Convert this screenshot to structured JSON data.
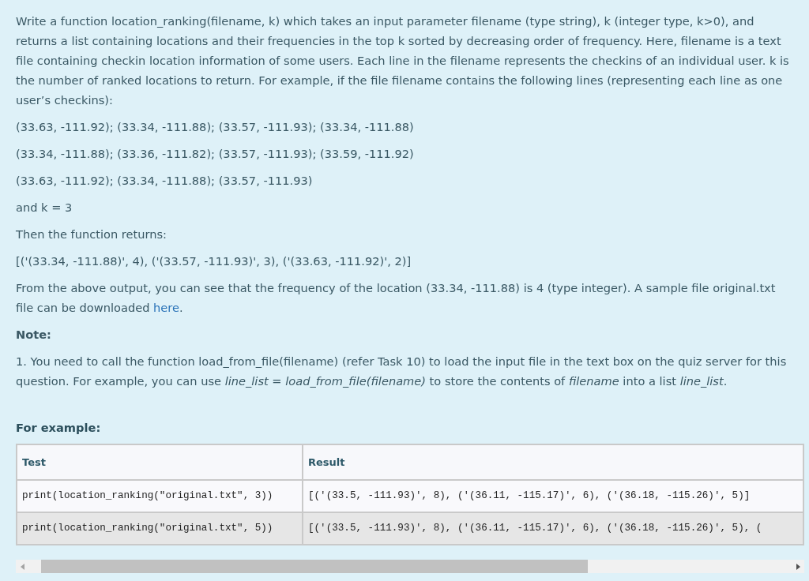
{
  "intro": "Write a function location_ranking(filename, k) which takes an input parameter filename (type string), k (integer type, k>0), and returns a list containing locations and their frequencies in the top k sorted by decreasing order of frequency.  Here, filename is a text file containing checkin location information of some users. Each line in the filename represents the checkins of an individual user. k is the number of ranked locations to return. For example, if the file filename contains the following lines (representing each line as one user’s checkins):",
  "file_lines": [
    "(33.63, -111.92); (33.34, -111.88); (33.57, -111.93); (33.34, -111.88)",
    "(33.34, -111.88); (33.36, -111.82); (33.57, -111.93); (33.59, -111.92)",
    "(33.63, -111.92); (33.34, -111.88); (33.57, -111.93)"
  ],
  "k_line": "and k = 3",
  "returns_line": "Then the function returns:",
  "output_line": "[('(33.34, -111.88)', 4), ('(33.57, -111.93)', 3), ('(33.63, -111.92)', 2)]",
  "explanation": {
    "text": "From the above output, you can see that the frequency of the location (33.34, -111.88) is 4 (type integer). A sample file original.txt file can be downloaded ",
    "link": "here",
    "after": "."
  },
  "note_heading": "Note:",
  "note_items": [
    "1. You need to call the function load_from_file(filename) (refer Task 10) to load the input file in the text box on the quiz server for this question. For example, you can use *line_list = load_from_file(filename)* to store the contents of *filename* into a list *line_list*."
  ],
  "example_heading": "For example:",
  "table": {
    "columns": [
      "Test",
      "Result"
    ],
    "rows": [
      [
        "print(location_ranking(\"original.txt\", 3))",
        "[('(33.5, -111.93)', 8), ('(36.11, -115.17)', 6), ('(36.18, -115.26)', 5)]"
      ],
      [
        "print(location_ranking(\"original.txt\", 5))",
        "[('(33.5, -111.93)', 8), ('(36.11, -115.17)', 6), ('(36.18, -115.26)', 5), ("
      ]
    ]
  }
}
